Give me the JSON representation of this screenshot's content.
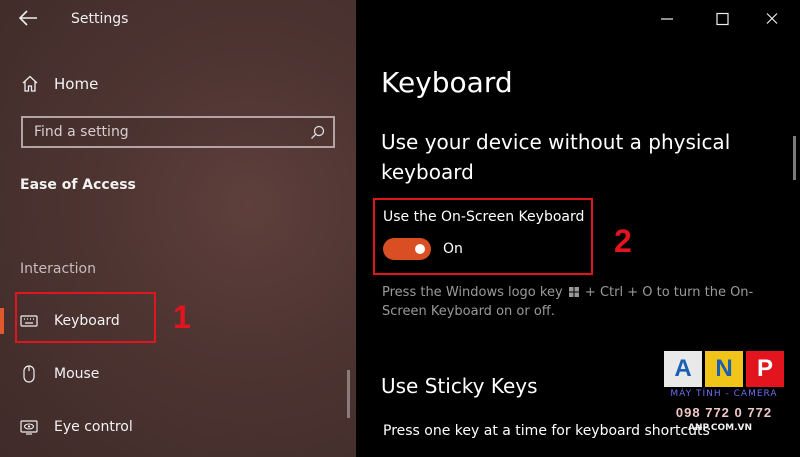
{
  "window": {
    "title": "Settings"
  },
  "sidebar": {
    "home_label": "Home",
    "search_placeholder": "Find a setting",
    "section_title": "Ease of Access",
    "group_label": "Interaction",
    "items": [
      {
        "label": "Keyboard",
        "icon": "keyboard-icon",
        "selected": true
      },
      {
        "label": "Mouse",
        "icon": "mouse-icon"
      },
      {
        "label": "Eye control",
        "icon": "eye-control-icon"
      }
    ]
  },
  "main": {
    "page_title": "Keyboard",
    "heading1": "Use your device without a physical keyboard",
    "toggle_label": "Use the On-Screen Keyboard",
    "toggle_state": "On",
    "desc_part1": "Press the Windows logo key",
    "desc_part2": "+ Ctrl + O to turn the On-Screen Keyboard on or off.",
    "heading2": "Use Sticky Keys",
    "body_text": "Press one key at a time for keyboard shortcuts"
  },
  "annotations": {
    "one": "1",
    "two": "2"
  },
  "watermark": {
    "letters": [
      "A",
      "N",
      "P"
    ],
    "line1": "MÁY TÍNH - CAMERA",
    "phone": "098 772 0 772",
    "site": "ANP.COM.VN"
  },
  "colors": {
    "accent": "#d94f23",
    "annotation": "#e2141e",
    "sidebar_bg": "#4d3431"
  }
}
